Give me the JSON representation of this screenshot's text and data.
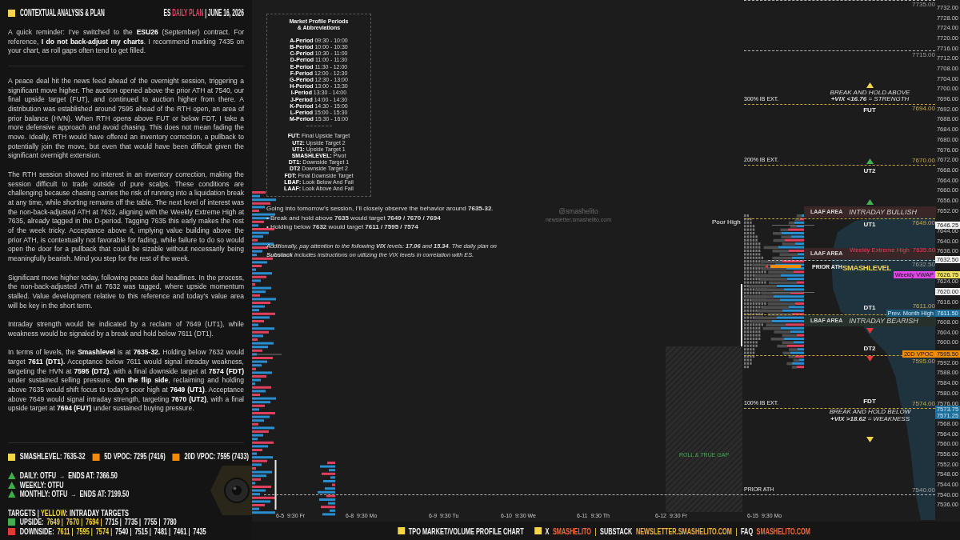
{
  "panel": {
    "title": "CONTEXTUAL ANALYSIS & PLAN",
    "plan_heading": [
      {
        "text": "ES",
        "kind": "plain"
      },
      {
        "text": "DAILY PLAN",
        "kind": "accent"
      },
      {
        "text": "| JUNE 16, 2026",
        "kind": "plain"
      }
    ],
    "reminder": "A quick reminder: I’ve switched to the **ESU26** (September) contract. For reference, **I do not back-adjust my charts**. I recommend marking 7435 on your chart, as roll gaps often tend to get filled.",
    "paragraphs": [
      "A peace deal hit the news feed ahead of the overnight session, triggering a significant move higher. The auction opened above the prior ATH at 7540, our final upside target (FUT), and continued to auction higher from there. A distribution was established around 7595 ahead of the RTH open, an area of prior balance (HVN). When RTH opens above FUT or below FDT, I take a more defensive approach and avoid chasing. This does not mean fading the move. Ideally, RTH would have offered an inventory correction, a pullback to potentially join the move, but even that would have been difficult given the significant overnight extension.",
      "The RTH session showed no interest in an inventory correction, making the session difficult to trade outside of pure scalps. These conditions are challenging because chasing carries the risk of running into a liquidation break at any time, while shorting remains off the table. The next level of interest was the non-back-adjusted ATH at 7632, aligning with the Weekly Extreme High at 7635, already tagged in the D-period. Tagging 7635 this early makes the rest of the week tricky. Acceptance above it, implying value building above the prior ATH, is contextually not favorable for fading, while failure to do so would open the door for a pullback that could be sizable without necessarily being meaningfully bearish. Mind you step for the rest of the week.",
      "Significant move higher today, following peace deal headlines. In the process, the non-back-adjusted ATH at 7632 was tagged, where upside momentum stalled. Value development relative to this reference and today’s value area will be key in the short term.",
      "Intraday strength would be indicated by a reclaim of 7649 (UT1), while weakness would be signaled by a break and hold below 7611 (DT1).",
      "In terms of levels, the **Smashlevel** is at **7635-32.** Holding below 7632 would target **7611 (DT1).** Acceptance below 7611 would signal intraday weakness, targeting the HVN at **7595 (DT2)**, with a final downside target at **7574 (FDT)** under sustained selling pressure. **On the flip side**, reclaiming and holding above 7635 would shift focus to today’s poor high at **7649 (UT1)**. Acceptance above 7649 would signal intraday strength, targeting **7670 (UT2)**, with a final upside target at **7694 (FUT)** under sustained buying pressure."
    ],
    "key_levels": [
      {
        "label": "SMASHLEVEL: 7635-32",
        "color": "#f5d547"
      },
      {
        "label": "5D VPOC: 7295 (7416)",
        "color": "#f58a07"
      },
      {
        "label": "20D VPOC: 7595 (7433)",
        "color": "#f58a07"
      }
    ],
    "trends": [
      {
        "label": "DAILY: OTFU",
        "arrow": "→",
        "ends": "ENDS AT: 7366.50"
      },
      {
        "label": "WEEKLY: OTFU"
      },
      {
        "label": "MONTHLY: OTFU",
        "arrow": "→",
        "ends": "ENDS AT: 7199.50"
      }
    ],
    "targets_heading": [
      {
        "text": "TARGETS |",
        "kind": "plain"
      },
      {
        "text": "YELLOW:",
        "kind": "highlight"
      },
      {
        "text": "INTRADAY TARGETS",
        "kind": "plain"
      }
    ],
    "target_rows": [
      {
        "label": "UPSIDE:",
        "color": "#43b049",
        "values": [
          {
            "text": "7649 |",
            "intraday": true
          },
          {
            "text": "7670 |",
            "intraday": true
          },
          {
            "text": "7694 |",
            "intraday": true
          },
          {
            "text": "7715 |",
            "intraday": false
          },
          {
            "text": "7735 |",
            "intraday": false
          },
          {
            "text": "7755 |",
            "intraday": false
          },
          {
            "text": "7780",
            "intraday": false
          }
        ]
      },
      {
        "label": "DOWNSIDE:",
        "color": "#e53935",
        "values": [
          {
            "text": "7611 |",
            "intraday": true
          },
          {
            "text": "7595 |",
            "intraday": true
          },
          {
            "text": "7574 |",
            "intraday": true
          },
          {
            "text": "7540 |",
            "intraday": false
          },
          {
            "text": "7515 |",
            "intraday": false
          },
          {
            "text": "7481 |",
            "intraday": false
          },
          {
            "text": "7461 |",
            "intraday": false
          },
          {
            "text": "7435",
            "intraday": false
          }
        ]
      }
    ]
  },
  "legend": {
    "title": [
      "Market Profile Periods",
      "& Abbreviations"
    ],
    "periods": [
      {
        "name": "A-Period",
        "time": "09:30 - 10:00"
      },
      {
        "name": "B-Period",
        "time": "10:00 - 10:30"
      },
      {
        "name": "C-Period",
        "time": "10:30 - 11:00"
      },
      {
        "name": "D-Period",
        "time": "11:00 - 11:30"
      },
      {
        "name": "E-Period",
        "time": "11:30 - 12:00"
      },
      {
        "name": "F-Period",
        "time": "12:00 - 12:30"
      },
      {
        "name": "G-Period",
        "time": "12:30 - 13:00"
      },
      {
        "name": "H-Period",
        "time": "13:00 - 13:30"
      },
      {
        "name": "I-Period",
        "time": "13:30 - 14:00"
      },
      {
        "name": "J-Period",
        "time": "14:00 - 14:30"
      },
      {
        "name": "K-Period",
        "time": "14:30 - 15:00"
      },
      {
        "name": "L-Period",
        "time": "15:00 - 15:30"
      },
      {
        "name": "M-Period",
        "time": "15:30 - 16:00"
      }
    ],
    "abbreviations": [
      {
        "abbr": "FUT:",
        "meaning": "Final Upside Target"
      },
      {
        "abbr": "UT2:",
        "meaning": "Upside Target 2"
      },
      {
        "abbr": "UT1:",
        "meaning": "Upside Target 1"
      },
      {
        "abbr": "SMASHLEVEL:",
        "meaning": "Pivot"
      },
      {
        "abbr": "DT1:",
        "meaning": "Downside Target 1"
      },
      {
        "abbr": "DT2",
        "meaning": "Downside Target 2"
      },
      {
        "abbr": "FDT:",
        "meaning": "Final Downside Target"
      },
      {
        "abbr": "LBAF:",
        "meaning": "Look Below And Fail"
      },
      {
        "abbr": "LAAF:",
        "meaning": "Look Above And Fail"
      }
    ]
  },
  "outlook": {
    "intro": "Going into tomorrow’s session, I’ll closely observe the behavior around **7635-32**.",
    "bullets": [
      "• Break and hold above **7635** would target **7649 / 7670 / 7694**",
      "• Holding below **7632** would target **7611 / 7595 / 7574**"
    ],
    "vix_note": "Additionally, pay attention to the following **VIX** levels: **17.06** and **15.34**. The daily plan on **Substack** includes instructions on utilizing the VIX levels in correlation with ES."
  },
  "chart": {
    "watermark": {
      "handle": "@smashelito",
      "site": "newsletter.smashelito.com"
    },
    "labels": [
      {
        "kind": "plain",
        "text": "Poor High"
      },
      {
        "kind": "small",
        "text": "PRIOR ATH"
      },
      {
        "kind": "pivot",
        "text": "SMASHLEVEL"
      }
    ],
    "levels": [
      {
        "price": "7735.00",
        "kind": "reference"
      },
      {
        "price": "7715.00",
        "kind": "reference"
      },
      {
        "price": "7694.00",
        "kind": "upside",
        "target": "FUT",
        "ib": "300% IB EXT.",
        "marker": {
          "kind": "up",
          "color": "#f2d34a"
        },
        "note": [
          "BREAK AND HOLD ABOVE",
          "**+VIX <16.76** = STRENGTH"
        ]
      },
      {
        "price": "7670.00",
        "kind": "upside",
        "target": "UT2",
        "ib": "200% IB EXT.",
        "marker": {
          "kind": "up",
          "color": "#3fb34f"
        }
      },
      {
        "price": "7649.00",
        "kind": "upside",
        "target": "UT1",
        "marker": {
          "kind": "up",
          "color": "#3fb34f"
        },
        "band": {
          "label": "LAAF AREA",
          "title": "INTRADAY BULLISH",
          "color": "#3a2626"
        }
      },
      {
        "price": "7635.00",
        "kind": "extreme",
        "name": "Weekly Extreme High",
        "band": {
          "label": "LAAF AREA",
          "color": "#3a2626"
        }
      },
      {
        "price": "7632.50",
        "kind": "reference"
      },
      {
        "price": "7611.00",
        "kind": "downside",
        "target": "DT1",
        "marker": {
          "kind": "down",
          "color": "#e53935"
        },
        "band": {
          "label": "LBAF AREA",
          "title": "INTRADAY BEARISH",
          "color": "#25312a"
        }
      },
      {
        "price": "7595.00",
        "kind": "downside",
        "target": "DT2",
        "marker": {
          "kind": "down",
          "color": "#e53935"
        }
      },
      {
        "price": "7574.00",
        "kind": "downside",
        "target": "FDT",
        "ib": "100% IB EXT.",
        "marker": {
          "kind": "down",
          "color": "#f2d34a"
        },
        "note": [
          "BREAK AND HOLD BELOW",
          "**+VIX >18.62** = WEAKNESS"
        ]
      },
      {
        "price": "7540.00",
        "kind": "reference",
        "ib": "PRIOR ATH"
      }
    ],
    "gap_label": "ROLL & TRUE GAP",
    "axis_ticks": [
      "7732.00",
      "7728.00",
      "7724.00",
      "7720.00",
      "7716.00",
      "7712.00",
      "7708.00",
      "7704.00",
      "7700.00",
      "7696.00",
      "7692.00",
      "7688.00",
      "7684.00",
      "7680.00",
      "7676.00",
      "7672.00",
      "7668.00",
      "7664.00",
      "7660.00",
      "7656.00",
      "7652.00",
      "7644.00",
      "7640.00",
      "7636.00",
      "7624.00",
      "7616.00",
      "7608.00",
      "7604.00",
      "7600.00",
      "7592.00",
      "7588.00",
      "7584.00",
      "7580.00",
      "7576.00",
      "7568.00",
      "7564.00",
      "7560.00",
      "7556.00",
      "7552.00",
      "7548.00",
      "7544.00",
      "7540.00",
      "7536.00"
    ],
    "axis_badges": [
      {
        "price": "7646.25",
        "color": "#f2f2f2"
      },
      {
        "price": "7632.50",
        "color": "#f2f2f2"
      },
      {
        "price": "7626.75",
        "color": "#f4e35c",
        "tag": {
          "text": "Weekly VWAP",
          "color": "#e046e8"
        }
      },
      {
        "price": "7620.00",
        "color": "#f2f2f2"
      },
      {
        "price": "7611.50",
        "color": "#1f6f9c",
        "tag": {
          "text": "Prev. Month High",
          "color": "#1c5a7c"
        }
      },
      {
        "price": "7595.50",
        "color": "#f28c00",
        "tag": {
          "text": "20D VPOC",
          "color": "#f28c00"
        }
      },
      {
        "price": "7573.75",
        "color": "#1f6f9c"
      },
      {
        "price": "7571.25",
        "color": "#1f6f9c"
      }
    ],
    "dates": [
      "6-5  9:30 Fr",
      "6-8  9:30 Mo",
      "6-9  9:30 Tu",
      "6-10  9:30 We",
      "6-11  9:30 Th",
      "6-12  9:30 Fr",
      "6-15  9:30 Mo"
    ]
  },
  "footer": [
    {
      "kind": "square",
      "color": "#f5d547"
    },
    {
      "kind": "label",
      "text": "TPO MARKET/VOLUME PROFILE CHART"
    },
    {
      "kind": "square",
      "color": "#f5d547"
    },
    {
      "kind": "label",
      "text": "X"
    },
    {
      "kind": "link",
      "text": "SMASHELITO",
      "color": "#f46a3c"
    },
    {
      "kind": "separator",
      "text": "|"
    },
    {
      "kind": "label",
      "text": "SUBSTACK"
    },
    {
      "kind": "link",
      "text": "NEWSLETTER.SMASHELITO.COM",
      "color": "#f3b33a"
    },
    {
      "kind": "separator",
      "text": "|"
    },
    {
      "kind": "label",
      "text": "FAQ"
    },
    {
      "kind": "link",
      "text": "SMASHELITO.COM",
      "color": "#f46a3c"
    }
  ]
}
